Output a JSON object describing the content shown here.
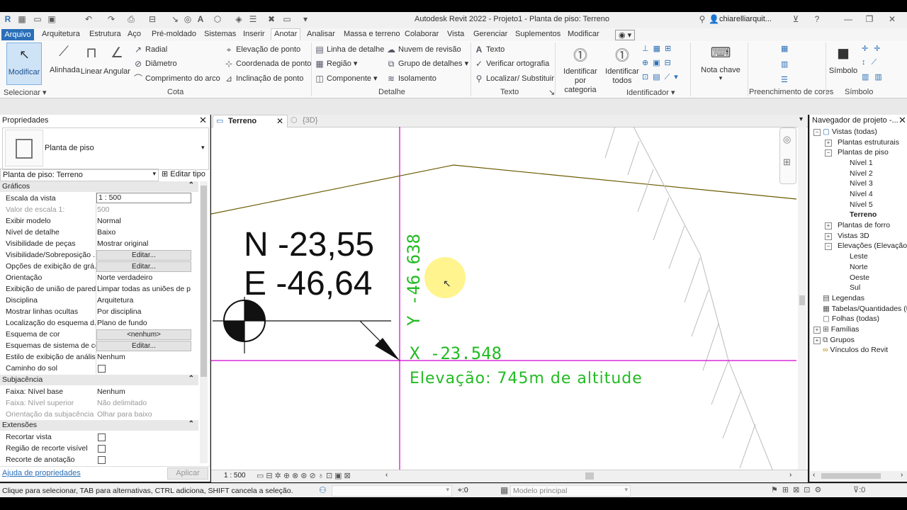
{
  "window": {
    "title": "Autodesk Revit 2022 - Projeto1 - Planta de piso: Terreno",
    "user": "chiarelliarquit..."
  },
  "menu": [
    "Arquivo",
    "Arquitetura",
    "Estrutura",
    "Aço",
    "Pré-moldado",
    "Sistemas",
    "Inserir",
    "Anotar",
    "Analisar",
    "Massa e terreno",
    "Colaborar",
    "Vista",
    "Gerenciar",
    "Suplementos",
    "Modificar"
  ],
  "ribbon": {
    "modificar": "Modificar",
    "selecionar": "Selecionar",
    "alinhada": "Alinhada",
    "linear": "Linear",
    "angular": "Angular",
    "radial": "Radial",
    "diametro": "Diâmetro",
    "comprimento": "Comprimento do arco",
    "elev_ponto": "Elevação de ponto",
    "coord_ponto": "Coordenada de ponto",
    "incl_ponto": "Inclinação de ponto",
    "cota": "Cota",
    "linha_detalhe": "Linha de detalhe",
    "regiao": "Região",
    "componente": "Componente",
    "nuvem": "Nuvem de revisão",
    "grupo": "Grupo de detalhes",
    "isolamento": "Isolamento",
    "detalhe": "Detalhe",
    "texto_btn": "Texto",
    "verificar": "Verificar ortografia",
    "localizar": "Localizar/ Substituir",
    "texto": "Texto",
    "ident_cat_1": "Identificar por",
    "ident_cat_2": "categoria",
    "ident_todos_1": "Identificar",
    "ident_todos_2": "todos",
    "identificador": "Identificador",
    "nota_chave": "Nota chave",
    "preenchimento": "Preenchimento de cores",
    "simbolo_btn": "Símbolo",
    "simbolo": "Símbolo"
  },
  "properties": {
    "title": "Propriedades",
    "type": "Planta de piso",
    "instance": "Planta de piso: Terreno",
    "edit_type": "Editar tipo",
    "sections": {
      "graficos": "Gráficos",
      "subjacencia": "Subjacência",
      "extensoes": "Extensões"
    },
    "rows": [
      {
        "k": "Escala da vista",
        "v": "1 : 500"
      },
      {
        "k": "Valor de escala    1:",
        "v": "500"
      },
      {
        "k": "Exibir modelo",
        "v": "Normal"
      },
      {
        "k": "Nível de detalhe",
        "v": "Baixo"
      },
      {
        "k": "Visibilidade de peças",
        "v": "Mostrar original"
      },
      {
        "k": "Visibilidade/Sobreposição ...",
        "v": "Editar..."
      },
      {
        "k": "Opções de exibição de grá...",
        "v": "Editar..."
      },
      {
        "k": "Orientação",
        "v": "Norte verdadeiro"
      },
      {
        "k": "Exibição de união de parede",
        "v": "Limpar todas as uniões de p..."
      },
      {
        "k": "Disciplina",
        "v": "Arquitetura"
      },
      {
        "k": "Mostrar linhas ocultas",
        "v": "Por disciplina"
      },
      {
        "k": "Localização do esquema d...",
        "v": "Plano de fundo"
      },
      {
        "k": "Esquema de cor",
        "v": "<nenhum>"
      },
      {
        "k": "Esquemas de sistema de cor",
        "v": "Editar..."
      },
      {
        "k": "Estilo de exibição de anális...",
        "v": "Nenhum"
      },
      {
        "k": "Caminho do sol",
        "v": ""
      },
      {
        "k": "Faixa: Nível base",
        "v": "Nenhum"
      },
      {
        "k": "Faixa: Nível superior",
        "v": "Não delimitado"
      },
      {
        "k": "Orientação da subjacência",
        "v": "Olhar para baixo"
      },
      {
        "k": "Recortar vista",
        "v": ""
      },
      {
        "k": "Região de recorte visível",
        "v": ""
      },
      {
        "k": "Recorte de anotação",
        "v": ""
      }
    ],
    "help": "Ajuda de propriedades",
    "apply": "Aplicar"
  },
  "view": {
    "tab1": "Terreno",
    "tab2": "{3D}",
    "north": "N -23,55",
    "east": "E -46,64",
    "ycoord": "Y -46.638",
    "xcoord": "X -23.548",
    "elevation": "Elevação: 745m de altitude",
    "scale": "1 : 500"
  },
  "browser": {
    "title": "Navegador de projeto -...",
    "items": [
      "Vistas (todas)",
      "Plantas estruturais",
      "Plantas de piso",
      "Nível 1",
      "Nível 2",
      "Nível 3",
      "Nível 4",
      "Nível 5",
      "Terreno",
      "Plantas de forro",
      "Vistas 3D",
      "Elevações (Elevação d",
      "Leste",
      "Norte",
      "Oeste",
      "Sul",
      "Legendas",
      "Tabelas/Quantidades (t",
      "Folhas (todas)",
      "Famílias",
      "Grupos",
      "Vínculos do Revit"
    ]
  },
  "status": {
    "hint": "Clique para selecionar, TAB para alternativas, CTRL adiciona, SHIFT cancela a seleção.",
    "zero1": ":0",
    "model": "Modelo principal",
    "zero2": ":0"
  },
  "colors": {
    "magenta": "#d000d0",
    "green": "#22bb22",
    "accent": "#2a6fb8"
  }
}
